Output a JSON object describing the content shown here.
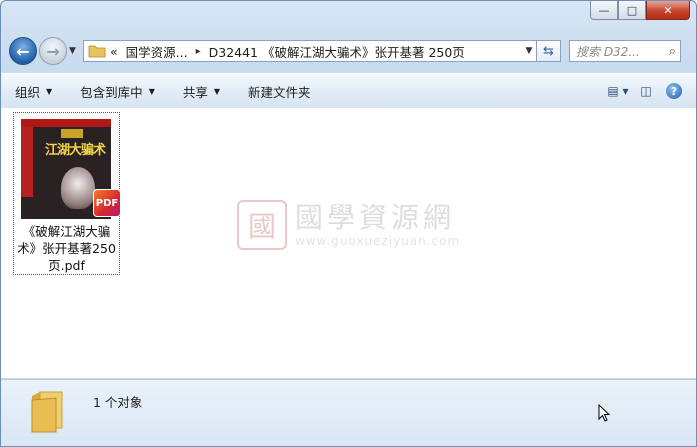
{
  "window": {
    "minimize_glyph": "—",
    "maximize_glyph": "□",
    "close_glyph": "✕"
  },
  "nav": {
    "back_glyph": "←",
    "forward_glyph": "→",
    "dropdown_glyph": "▼"
  },
  "address": {
    "overflow": "«",
    "crumbs": [
      "国学资源...",
      "D32441 《破解江湖大骗术》张开基著  250页"
    ],
    "separator": "▸",
    "dropdown_glyph": "▼",
    "refresh_glyph": "⇆"
  },
  "search": {
    "placeholder": "搜索 D32...",
    "icon": "search-icon"
  },
  "toolbar": {
    "organize": "组织",
    "include_library": "包含到库中",
    "share": "共享",
    "new_folder": "新建文件夹",
    "arrow": "▼",
    "view_glyph": "▤ ▾",
    "pane_glyph": "◫",
    "help_glyph": "?"
  },
  "files": [
    {
      "name": "《破解江湖大骗术》张开基著250页.pdf",
      "thumb_title": "江湖大骗术",
      "badge": "PDF",
      "type": "pdf"
    }
  ],
  "watermark": {
    "logo_char": "國",
    "name": "國學資源網",
    "url": "www.guoxueziyuan.com"
  },
  "status": {
    "count": "1 个对象"
  },
  "colors": {
    "frame": "#c9dbee",
    "toolbar": "#e2ecf7",
    "pdf_badge": "#d9262e"
  }
}
